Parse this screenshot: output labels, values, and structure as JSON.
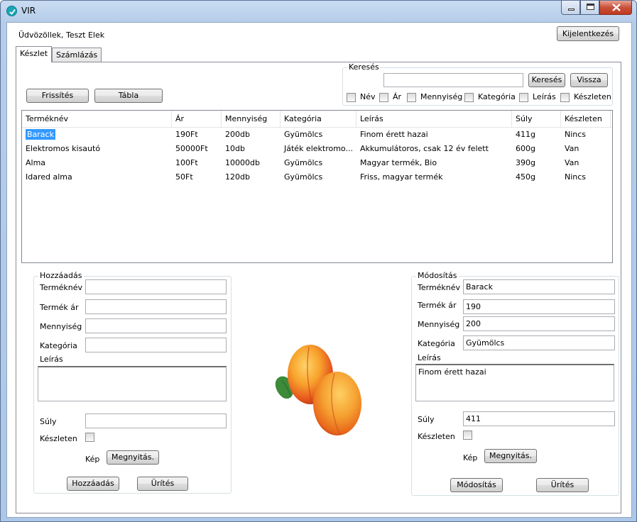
{
  "window": {
    "title": "VIR"
  },
  "header": {
    "greeting": "Üdvözöllek, Teszt Elek",
    "logout_label": "Kijelentkezés"
  },
  "tabs": [
    {
      "label": "Készlet"
    },
    {
      "label": "Számlázás"
    }
  ],
  "toolbar": {
    "refresh_label": "Frissítés",
    "table_label": "Tábla"
  },
  "search": {
    "legend": "Keresés",
    "value": "",
    "search_button": "Keresés",
    "back_button": "Vissza",
    "filters": [
      {
        "label": "Név",
        "checked": false
      },
      {
        "label": "Ár",
        "checked": false
      },
      {
        "label": "Mennyiség",
        "checked": false
      },
      {
        "label": "Kategória",
        "checked": false
      },
      {
        "label": "Leírás",
        "checked": false
      },
      {
        "label": "Készleten",
        "checked": false
      }
    ]
  },
  "table": {
    "columns": [
      "Terméknév",
      "Ár",
      "Mennyiség",
      "Kategória",
      "Leírás",
      "Súly",
      "Készleten"
    ],
    "rows": [
      [
        "Barack",
        "190Ft",
        "200db",
        "Gyümölcs",
        "Finom érett hazai",
        "411g",
        "Nincs"
      ],
      [
        "Elektromos kisautó",
        "50000Ft",
        "10db",
        "Játék elektromo...",
        "Akkumulátoros, csak 12 év felett",
        "600g",
        "Van"
      ],
      [
        "Alma",
        "100Ft",
        "10000db",
        "Gyümölcs",
        "Magyar termék, Bio",
        "390g",
        "Van"
      ],
      [
        "Idared alma",
        "50Ft",
        "120db",
        "Gyümölcs",
        "Friss, magyar termék",
        "450g",
        "Nincs"
      ]
    ],
    "selected_row": 0
  },
  "add_form": {
    "legend": "Hozzáadás",
    "name_label": "Terméknév",
    "name_value": "",
    "price_label": "Termék ár",
    "price_value": "",
    "qty_label": "Mennyiség",
    "qty_value": "",
    "category_label": "Kategória",
    "category_value": "",
    "desc_label": "Leírás",
    "desc_value": "",
    "weight_label": "Súly",
    "weight_value": "",
    "stock_label": "Készleten",
    "image_label": "Kép",
    "open_button": "Megnyitás.",
    "submit_button": "Hozzáadás",
    "clear_button": "Ürítés"
  },
  "edit_form": {
    "legend": "Módosítás",
    "name_label": "Terméknév",
    "name_value": "Barack",
    "price_label": "Termék ár",
    "price_value": "190",
    "qty_label": "Mennyiség",
    "qty_value": "200",
    "category_label": "Kategória",
    "category_value": "Gyümölcs",
    "desc_label": "Leírás",
    "desc_value": "Finom érett hazai",
    "weight_label": "Súly",
    "weight_value": "411",
    "stock_label": "Készleten",
    "image_label": "Kép",
    "open_button": "Megnyitás.",
    "submit_button": "Módosítás",
    "clear_button": "Ürítés"
  },
  "colors": {
    "selection": "#3399ff",
    "title_bar": "#b6cde9",
    "close_button": "#c8513b"
  }
}
